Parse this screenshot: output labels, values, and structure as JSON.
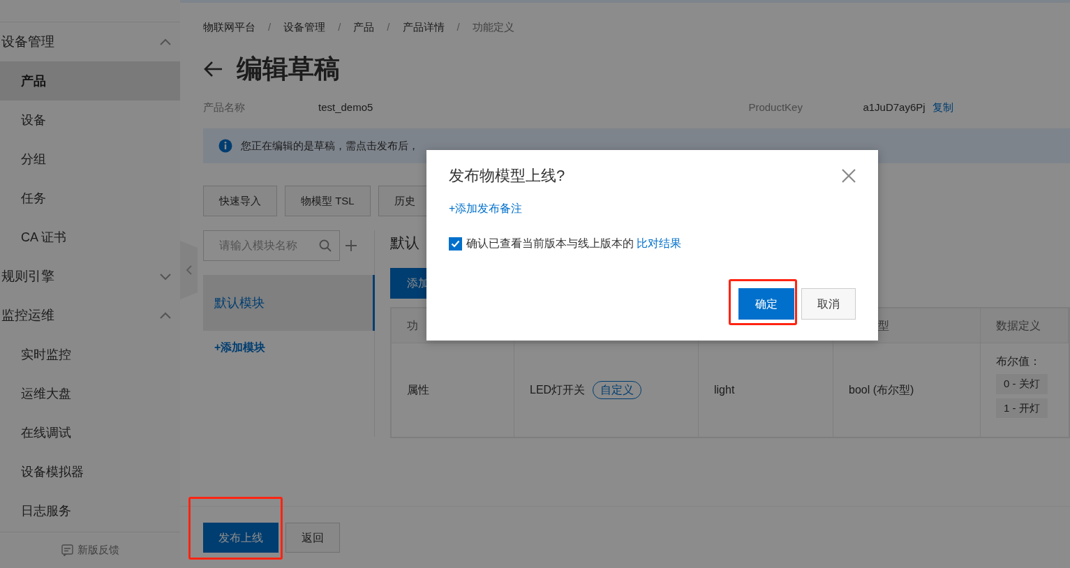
{
  "sidebar": {
    "groups": [
      {
        "label": "设备管理",
        "expanded": true,
        "children": [
          {
            "label": "产品",
            "selected": true
          },
          {
            "label": "设备",
            "selected": false
          },
          {
            "label": "分组",
            "selected": false
          },
          {
            "label": "任务",
            "selected": false
          },
          {
            "label": "CA 证书",
            "selected": false
          }
        ]
      },
      {
        "label": "规则引擎",
        "expanded": false
      },
      {
        "label": "监控运维",
        "expanded": true,
        "children": [
          {
            "label": "实时监控",
            "selected": false
          },
          {
            "label": "运维大盘",
            "selected": false
          },
          {
            "label": "在线调试",
            "selected": false
          },
          {
            "label": "设备模拟器",
            "selected": false
          },
          {
            "label": "日志服务",
            "selected": false
          }
        ]
      }
    ],
    "feedback": "新版反馈"
  },
  "breadcrumb": [
    {
      "label": "物联网平台"
    },
    {
      "separator": "/",
      "label": "设备管理"
    },
    {
      "separator": "/",
      "label": "产品"
    },
    {
      "separator": "/",
      "label": "产品详情"
    },
    {
      "separator": "/",
      "label": "功能定义"
    }
  ],
  "page_title": "编辑草稿",
  "product_info": [
    {
      "label": "产品名称",
      "value": "test_demo5"
    },
    {
      "label": "ProductKey",
      "value": "a1JuD7ay6Pj",
      "action": "复制"
    }
  ],
  "alert": "您正在编辑的是草稿，需点击发布后，",
  "toolbar_buttons": [
    "快速导入",
    "物模型 TSL",
    "历史"
  ],
  "modules": {
    "search_placeholder": "请输入模块名称",
    "items": [
      {
        "label": "默认模块",
        "selected": true
      }
    ],
    "add_link": "+添加模块"
  },
  "module_panel": {
    "heading": "默认",
    "add_button": "添加",
    "table": {
      "header": {
        "column_1": "功",
        "column_4": "型",
        "column_5": "数据定义"
      },
      "rows": [
        {
          "type": "属性",
          "name": "LED灯开关",
          "tag": "自定义",
          "identifier": "light",
          "data_type": "bool (布尔型)",
          "definition": {
            "label": "布尔值：",
            "values": [
              "0 - 关灯",
              "1 - 开灯"
            ]
          }
        }
      ]
    }
  },
  "footer_buttons": [
    {
      "label": "发布上线",
      "kind": "primary",
      "highlighted": true
    },
    {
      "label": "返回",
      "kind": "default",
      "highlighted": false
    }
  ],
  "modal": {
    "title": "发布物模型上线?",
    "note_link": "+添加发布备注",
    "confirm": {
      "checked": true,
      "text": "确认已查看当前版本与线上版本的",
      "link": "比对结果"
    },
    "buttons": [
      {
        "label": "确定",
        "kind": "primary",
        "highlighted": true
      },
      {
        "label": "取消",
        "kind": "default",
        "highlighted": false
      }
    ]
  }
}
